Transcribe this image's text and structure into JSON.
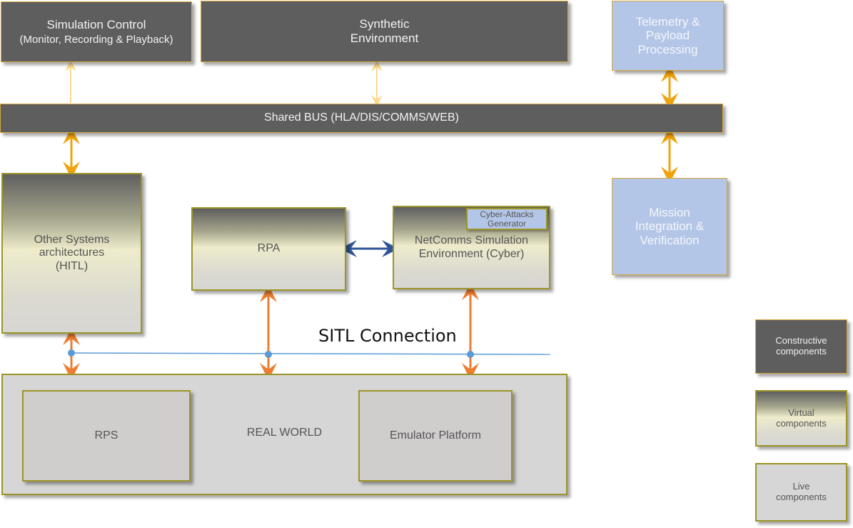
{
  "diagram": {
    "blocks": {
      "simulation_control": {
        "line1": "Simulation  Control",
        "line2": "(Monitor, Recording & Playback)",
        "category": "constructive"
      },
      "synthetic_environment": {
        "line1": "Synthetic",
        "line2": "Environment",
        "category": "constructive"
      },
      "telemetry": {
        "line1": "Telemetry &",
        "line2": "Payload",
        "line3": "Processing",
        "category": "external"
      },
      "shared_bus": {
        "label": "Shared BUS (HLA/DIS/COMMS/WEB)",
        "category": "constructive"
      },
      "other_systems": {
        "line1": "Other Systems",
        "line2": "architectures",
        "line3": "(HITL)",
        "category": "virtual"
      },
      "rpa": {
        "label": "RPA",
        "category": "virtual"
      },
      "netcomms": {
        "line1": "NetComms Simulation",
        "line2": "Environment  (Cyber)",
        "category": "virtual"
      },
      "cyber_attacks": {
        "line1": "Cyber-Attacks",
        "line2": "Generator",
        "category": "external"
      },
      "mission_integration": {
        "line1": "Mission",
        "line2": "Integration &",
        "line3": "Verification",
        "category": "external"
      },
      "real_world": {
        "label": "REAL WORLD",
        "category": "live"
      },
      "rps": {
        "label": "RPS",
        "category": "live"
      },
      "emulator": {
        "label": "Emulator  Platform",
        "category": "live"
      }
    },
    "sitl_label": "SITL Connection",
    "legend": [
      {
        "line1": "Constructive",
        "line2": "components",
        "category": "constructive"
      },
      {
        "line1": "Virtual",
        "line2": "components",
        "category": "virtual"
      },
      {
        "line1": "Live",
        "line2": "components",
        "category": "live"
      }
    ],
    "connections": [
      {
        "from": "shared_bus",
        "to": "simulation_control",
        "style": "light-orange",
        "direction": "to-top"
      },
      {
        "from": "shared_bus",
        "to": "synthetic_environment",
        "style": "light-orange",
        "direction": "both"
      },
      {
        "from": "shared_bus",
        "to": "telemetry",
        "style": "orange",
        "direction": "both"
      },
      {
        "from": "shared_bus",
        "to": "other_systems",
        "style": "orange",
        "direction": "both"
      },
      {
        "from": "shared_bus",
        "to": "mission_integration",
        "style": "orange",
        "direction": "both"
      },
      {
        "from": "rpa",
        "to": "netcomms",
        "style": "blue",
        "direction": "both"
      },
      {
        "from": "other_systems",
        "to": "real_world",
        "style": "dark-orange",
        "direction": "both"
      },
      {
        "from": "rpa",
        "to": "real_world",
        "style": "dark-orange",
        "direction": "both"
      },
      {
        "from": "netcomms",
        "to": "real_world",
        "style": "dark-orange",
        "direction": "both"
      }
    ],
    "colors": {
      "constructive": "#5e5e5e",
      "external": "#b4c6e7",
      "live": "#d6d6d6",
      "border_gold": "#d9a83a",
      "border_olive": "#9c9426",
      "arrow_orange": "#f0a30a",
      "arrow_light_orange": "#fad88c",
      "arrow_dark_orange": "#ed7d31",
      "arrow_blue": "#2f5597",
      "sitl_line": "#5b9bd5"
    }
  }
}
